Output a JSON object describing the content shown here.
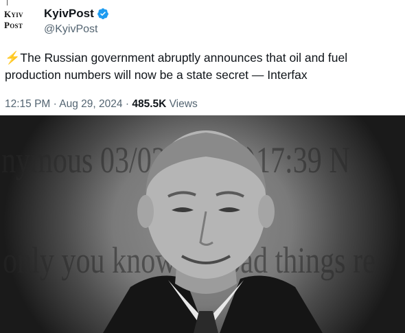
{
  "account": {
    "logo_line1": "Kyiv",
    "logo_line2": "Post",
    "display_name": "KyivPost",
    "handle": "@KyivPost",
    "verified": true
  },
  "tweet": {
    "emoji": "⚡",
    "text": "The Russian government abruptly announces that oil and fuel production numbers will now be a state secret — Interfax"
  },
  "meta": {
    "time": "12:15 PM",
    "separator1": "·",
    "date": "Aug 29, 2024",
    "separator2": "·",
    "views_count": "485.5K",
    "views_label": "Views"
  },
  "media": {
    "overlay_line1": "nymous 03/02/17(Fri)17:39 N",
    "overlay_line2": "only you know the bad things re"
  },
  "colors": {
    "text_primary": "#0f1419",
    "text_secondary": "#536471",
    "verified_blue": "#1d9bf0",
    "bolt": "#f4a100"
  }
}
